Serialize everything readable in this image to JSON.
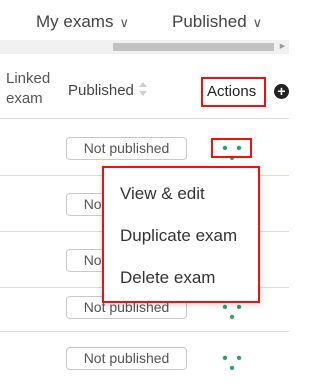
{
  "filters": {
    "my_exams": "My exams",
    "published": "Published",
    "chevron": "∨"
  },
  "table": {
    "headers": {
      "linked_exam": "Linked\nexam",
      "published": "Published",
      "actions": "Actions"
    },
    "rows": [
      {
        "status": "Not published",
        "actions": "• • •"
      },
      {
        "status": "Not published",
        "actions": "• • •"
      },
      {
        "status": "Not published",
        "actions": "• • •"
      },
      {
        "status": "Not published",
        "actions": "• • •"
      },
      {
        "status": "Not published",
        "actions": "• • •"
      }
    ]
  },
  "action_menu": {
    "items": [
      "View & edit",
      "Duplicate exam",
      "Delete exam"
    ]
  },
  "icons": {
    "sort": "sort-icon",
    "add": "plus-circle-icon",
    "scroll_right": "scroll-right-arrow-icon"
  },
  "colors": {
    "highlight": "#ee1111",
    "dots": "#2aa36a"
  }
}
